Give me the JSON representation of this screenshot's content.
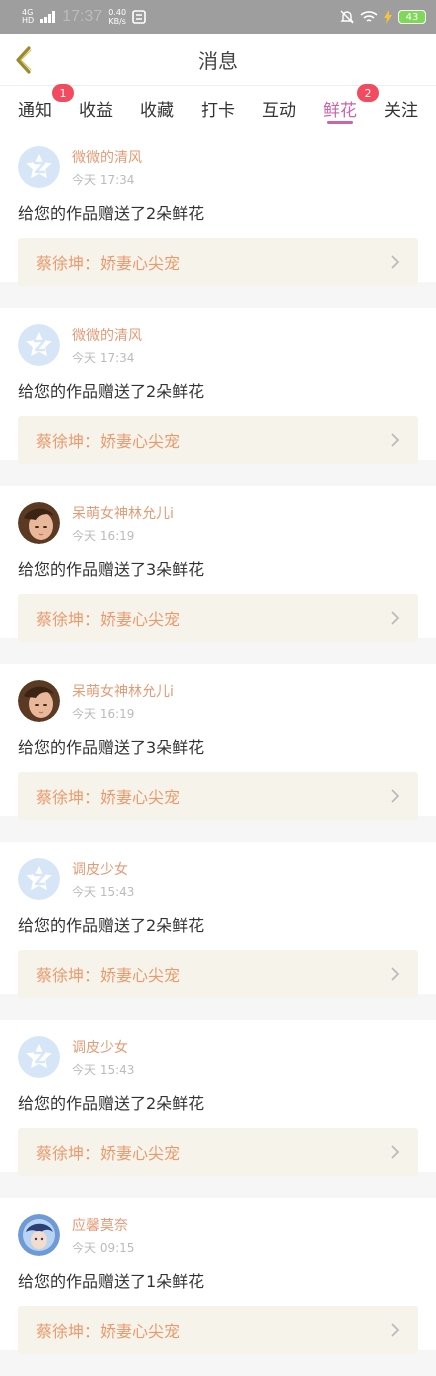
{
  "status_bar": {
    "network": "4G",
    "network_sub": "HD",
    "time": "17:37",
    "speed_value": "0.40",
    "speed_unit": "KB/s",
    "battery": "43"
  },
  "header": {
    "title": "消息"
  },
  "tabs": [
    {
      "label": "通知",
      "badge": "1"
    },
    {
      "label": "收益",
      "badge": ""
    },
    {
      "label": "收藏",
      "badge": ""
    },
    {
      "label": "打卡",
      "badge": ""
    },
    {
      "label": "互动",
      "badge": ""
    },
    {
      "label": "鲜花",
      "badge": "2",
      "active": true
    },
    {
      "label": "关注",
      "badge": ""
    }
  ],
  "messages": [
    {
      "name": "微微的清风",
      "time": "今天 17:34",
      "text": "给您的作品赠送了2朵鲜花",
      "work": "蔡徐坤：娇妻心尖宠",
      "avatar": "default-avatar"
    },
    {
      "name": "微微的清风",
      "time": "今天 17:34",
      "text": "给您的作品赠送了2朵鲜花",
      "work": "蔡徐坤：娇妻心尖宠",
      "avatar": "default-avatar"
    },
    {
      "name": "呆萌女神林允儿i",
      "time": "今天 16:19",
      "text": "给您的作品赠送了3朵鲜花",
      "work": "蔡徐坤：娇妻心尖宠",
      "avatar": "photo-avatar"
    },
    {
      "name": "呆萌女神林允儿i",
      "time": "今天 16:19",
      "text": "给您的作品赠送了3朵鲜花",
      "work": "蔡徐坤：娇妻心尖宠",
      "avatar": "photo-avatar"
    },
    {
      "name": "调皮少女",
      "time": "今天 15:43",
      "text": "给您的作品赠送了2朵鲜花",
      "work": "蔡徐坤：娇妻心尖宠",
      "avatar": "default-avatar"
    },
    {
      "name": "调皮少女",
      "time": "今天 15:43",
      "text": "给您的作品赠送了2朵鲜花",
      "work": "蔡徐坤：娇妻心尖宠",
      "avatar": "default-avatar"
    },
    {
      "name": "应馨莫奈",
      "time": "今天 09:15",
      "text": "给您的作品赠送了1朵鲜花",
      "work": "蔡徐坤：娇妻心尖宠",
      "avatar": "anime-avatar"
    }
  ],
  "colors": {
    "accent": "#c966a8",
    "name": "#e49b76",
    "work": "#ea9a6e",
    "badge": "#f24a5f"
  }
}
